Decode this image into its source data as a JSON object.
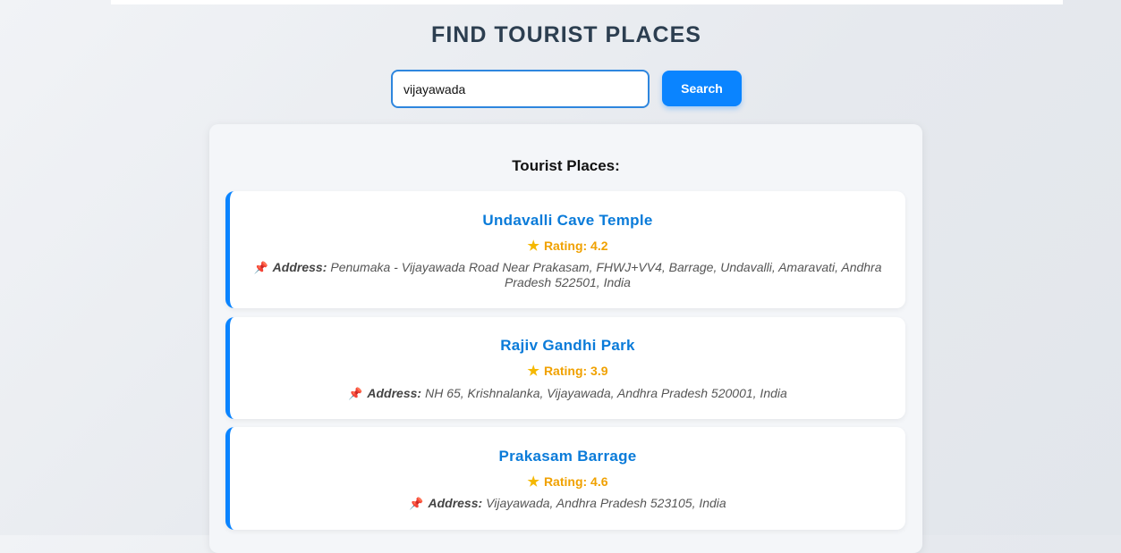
{
  "header": {
    "title": "FIND TOURIST PLACES"
  },
  "search": {
    "value": "vijayawada",
    "button_label": "Search"
  },
  "results": {
    "heading": "Tourist Places:",
    "places": [
      {
        "name": "Undavalli Cave Temple",
        "rating_text": "Rating: 4.2",
        "address_label": "Address:",
        "address": "Penumaka - Vijayawada Road Near Prakasam, FHWJ+VV4, Barrage, Undavalli, Amaravati, Andhra Pradesh 522501, India"
      },
      {
        "name": "Rajiv Gandhi Park",
        "rating_text": "Rating: 3.9",
        "address_label": "Address:",
        "address": "NH 65, Krishnalanka, Vijayawada, Andhra Pradesh 520001, India"
      },
      {
        "name": "Prakasam Barrage",
        "rating_text": "Rating: 4.6",
        "address_label": "Address:",
        "address": "Vijayawada, Andhra Pradesh 523105, India"
      }
    ]
  },
  "icons": {
    "rating": "star-icon",
    "address": "pushpin-icon"
  },
  "colors": {
    "accent": "#0a84ff",
    "title": "#2c3e50",
    "place_name": "#0a7bd9",
    "rating": "#f0a100",
    "pin": "#d9345a"
  }
}
